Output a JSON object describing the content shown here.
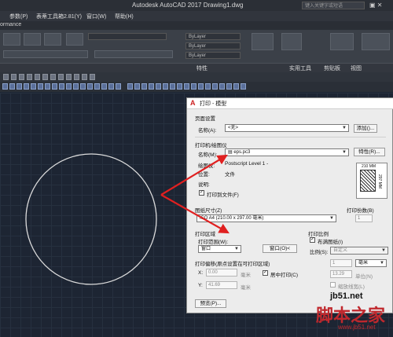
{
  "app": {
    "title": "Autodesk AutoCAD 2017    Drawing1.dwg",
    "search_placeholder": "键入关键字或短语",
    "window_icons": "▣ ✕"
  },
  "menu": [
    {
      "label": "参数(P)"
    },
    {
      "label": "表蒂工具箱2.81(Y)"
    },
    {
      "label": "窗口(W)"
    },
    {
      "label": "帮助(H)"
    }
  ],
  "tabs": {
    "current": "ormance"
  },
  "ribbon": {
    "layer_value_1": "ByLayer",
    "layer_value_2": "ByLayer",
    "layer_value_3": "ByLayer",
    "panels": [
      {
        "label": "特性"
      },
      {
        "label": "实用工具"
      },
      {
        "label": "剪贴板"
      },
      {
        "label": "视图"
      }
    ]
  },
  "dialog": {
    "title": "打印 - 模型",
    "page_setup": {
      "section": "页面设置",
      "name_label": "名称(A):",
      "name_value": "<无>",
      "add_button": "添加()..."
    },
    "printer": {
      "section": "打印机/绘图仪",
      "name_label": "名称(M):",
      "name_value": "eps.pc3",
      "properties_button": "特性(R)...",
      "plotter_label": "绘图仪:",
      "plotter_value": "Postscript Level 1 -",
      "location_label": "位置:",
      "location_value": "文件",
      "description_label": "说明:",
      "print_to_file": "打印到文件(F)",
      "paper_width": "210 MM",
      "paper_height": "297 MM"
    },
    "paper": {
      "section": "图纸尺寸(Z)",
      "value": "ISO A4 (210.00 x 297.00 毫米)"
    },
    "copies": {
      "label": "打印份数(B)",
      "value": "1"
    },
    "area": {
      "section": "打印区域",
      "range_label": "打印范围(W):",
      "range_value": "窗口",
      "window_button": "窗口(O)<"
    },
    "scale": {
      "section": "打印比例",
      "fit_paper": "布满图纸(I)",
      "scale_label": "比例(S):",
      "scale_value": "自定义",
      "value1": "1",
      "unit": "毫米",
      "value2": "13.29",
      "unit_label": "单位(N)",
      "scale_lineweights": "缩放线宽(L)"
    },
    "offset": {
      "section": "打印偏移(原点设置在可打印区域)",
      "x_label": "X:",
      "x_value": "0.00",
      "x_unit": "毫米",
      "y_label": "Y:",
      "y_value": "41.69",
      "y_unit": "毫米",
      "center_plot": "居中打印(C)"
    },
    "preview_button": "预览(P)..."
  },
  "watermark": {
    "site": "jb51.net",
    "brand": "脚本之家",
    "url": "www.jb51.net"
  },
  "colors": {
    "canvas": "#1d2533",
    "arrow": "#e02020",
    "circle": "#dcdcdc"
  }
}
